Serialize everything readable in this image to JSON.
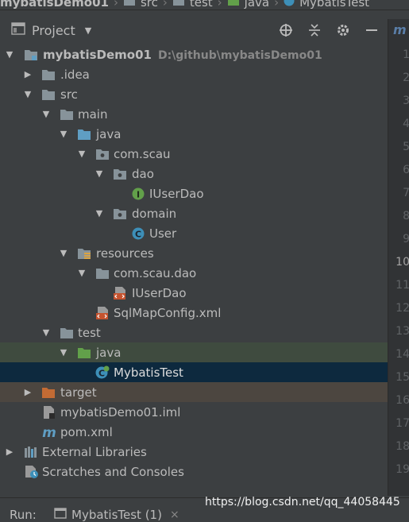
{
  "breadcrumb": {
    "items": [
      "mybatisDemo01",
      "src",
      "test",
      "java",
      "MybatisTest"
    ]
  },
  "panel": {
    "title": "Project"
  },
  "tree": [
    {
      "label": "mybatisDemo01",
      "path": "D:\\github\\mybatisDemo01",
      "icon": "module-folder-icon",
      "expanded": true
    },
    {
      "label": ".idea",
      "icon": "folder-icon",
      "expanded": false
    },
    {
      "label": "src",
      "icon": "folder-icon",
      "expanded": true
    },
    {
      "label": "main",
      "icon": "folder-icon",
      "expanded": true
    },
    {
      "label": "java",
      "icon": "source-folder-icon",
      "expanded": true
    },
    {
      "label": "com.scau",
      "icon": "package-icon",
      "expanded": true
    },
    {
      "label": "dao",
      "icon": "package-icon",
      "expanded": true
    },
    {
      "label": "IUserDao",
      "icon": "interface-icon"
    },
    {
      "label": "domain",
      "icon": "package-icon",
      "expanded": true
    },
    {
      "label": "User",
      "icon": "class-icon"
    },
    {
      "label": "resources",
      "icon": "resources-folder-icon",
      "expanded": true
    },
    {
      "label": "com.scau.dao",
      "icon": "folder-icon",
      "expanded": true
    },
    {
      "label": "IUserDao",
      "icon": "xml-file-icon"
    },
    {
      "label": "SqlMapConfig.xml",
      "icon": "xml-file-icon"
    },
    {
      "label": "test",
      "icon": "folder-icon",
      "expanded": true
    },
    {
      "label": "java",
      "icon": "test-source-folder-icon",
      "expanded": true
    },
    {
      "label": "MybatisTest",
      "icon": "test-class-icon"
    },
    {
      "label": "target",
      "icon": "excluded-folder-icon",
      "expanded": false
    },
    {
      "label": "mybatisDemo01.iml",
      "icon": "iml-file-icon"
    },
    {
      "label": "pom.xml",
      "icon": "maven-icon"
    },
    {
      "label": "External Libraries",
      "icon": "libraries-icon",
      "expanded": false
    },
    {
      "label": "Scratches and Consoles",
      "icon": "scratches-icon"
    }
  ],
  "gutter": {
    "file_letter": "m",
    "line_numbers": [
      "1",
      "2",
      "3",
      "4",
      "5",
      "6",
      "7",
      "8",
      "9",
      "10",
      "11",
      "12",
      "13",
      "14",
      "15",
      "16",
      "17",
      "18",
      "19"
    ],
    "current_line": "10"
  },
  "run": {
    "label": "Run:",
    "tab": "MybatisTest (1)",
    "close": "×"
  },
  "watermark": "https://blog.csdn.net/qq_44058445",
  "colors": {
    "background": "#3c3f41",
    "text": "#bbbbbb",
    "folder": "#87939a",
    "source_folder": "#5f9ec3",
    "test_folder": "#62a04a",
    "excluded_folder": "#c36b34",
    "selected_row": "#0d293e",
    "green_row": "#3f4b3f"
  }
}
